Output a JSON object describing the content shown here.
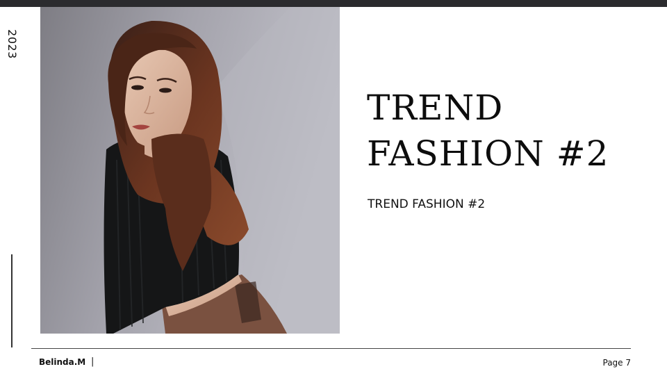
{
  "slide": {
    "year": "2023",
    "title_line1": "TREND",
    "title_line2": "FASHION #2",
    "subtitle": "TREND FASHION #2",
    "author": "Belinda.M",
    "author_separator": "|",
    "page_label": "Page 7"
  },
  "photo": {
    "subject": "woman with long auburn hair in black ribbed crop sweater and brown skirt against grey wall"
  }
}
